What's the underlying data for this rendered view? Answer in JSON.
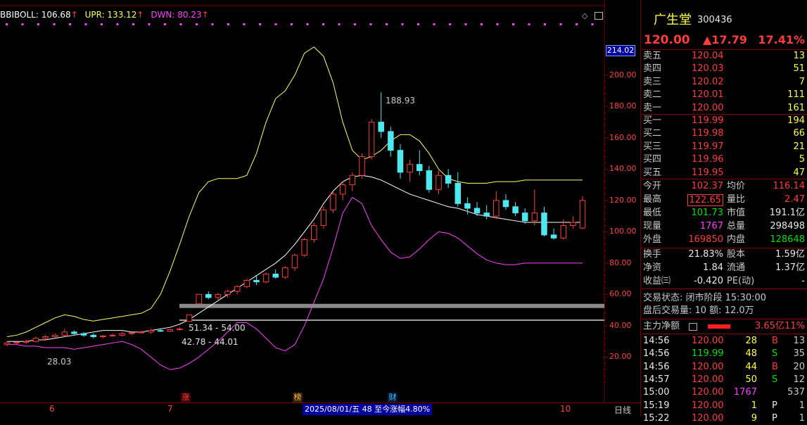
{
  "indicator": {
    "name": "BBIBOLL",
    "bbi_label": "BBIBOLL: 106.68",
    "upr_label": "UPR: 133.12",
    "dwn_label": "DWN: 80.23",
    "colors": {
      "bbi": "#ffffff",
      "upr": "#ffff60",
      "dwn": "#ff40ff"
    }
  },
  "chart": {
    "top_right_price_tag": "214.02",
    "peak_annotation": "188.93",
    "low_annotation": "28.03",
    "gap_labels": [
      "51.34 - 54.00",
      "42.78 - 44.01"
    ],
    "markers": [
      {
        "text": "涨",
        "color": "#ff4040"
      },
      {
        "text": "榜",
        "color": "#ffbb40"
      },
      {
        "text": "财",
        "color": "#40c0ff"
      }
    ],
    "status_bar": "2025/08/01/五 48 至今涨幅4.80%",
    "period_label": "日线",
    "x_ticks": [
      "6",
      "7",
      "10"
    ],
    "colors": {
      "up": "#ff3c3c",
      "down": "#50e8f0",
      "gap": "#a0a0a0"
    }
  },
  "chart_data": {
    "type": "candlestick",
    "ylim": [
      0,
      230
    ],
    "y_ticks": [
      "20.00",
      "40.00",
      "60.00",
      "80.00",
      "100.00",
      "120.00",
      "140.00",
      "160.00",
      "180.00",
      "200.00"
    ],
    "series": [
      {
        "name": "BBIBOLL",
        "values": [
          30,
          30,
          30,
          31,
          31,
          32,
          33,
          34,
          35,
          36,
          37,
          37,
          37,
          36,
          36,
          37,
          38,
          39,
          41,
          44,
          48,
          52,
          56,
          60,
          64,
          68,
          72,
          76,
          80,
          85,
          92,
          100,
          108,
          118,
          126,
          132,
          135,
          136,
          135,
          133,
          130,
          127,
          124,
          122,
          120,
          118,
          116,
          115,
          113,
          111,
          110,
          109,
          108,
          107,
          106,
          106,
          106,
          106,
          106,
          106,
          106
        ]
      },
      {
        "name": "UPR",
        "values": [
          33,
          34,
          36,
          39,
          42,
          45,
          47,
          46,
          44,
          43,
          44,
          45,
          46,
          47,
          48,
          51,
          60,
          75,
          92,
          110,
          125,
          132,
          134,
          134,
          134,
          136,
          150,
          170,
          185,
          190,
          200,
          214,
          218,
          212,
          195,
          170,
          152,
          146,
          148,
          152,
          158,
          162,
          162,
          158,
          150,
          140,
          134,
          132,
          131,
          131,
          131,
          132,
          132,
          132,
          133,
          133,
          133,
          133,
          133,
          133,
          133
        ]
      },
      {
        "name": "DWN",
        "values": [
          28,
          28,
          27,
          27,
          26,
          26,
          26,
          25,
          26,
          27,
          28,
          29,
          30,
          28,
          25,
          20,
          15,
          12,
          13,
          16,
          20,
          25,
          30,
          36,
          42,
          42,
          38,
          32,
          26,
          24,
          28,
          40,
          55,
          70,
          90,
          112,
          122,
          118,
          104,
          95,
          87,
          83,
          84,
          89,
          95,
          100,
          99,
          96,
          91,
          86,
          82,
          80,
          79,
          79,
          80,
          80,
          80,
          80,
          80,
          80,
          80
        ]
      }
    ],
    "candles": [
      {
        "o": 28,
        "h": 30,
        "l": 27,
        "c": 29
      },
      {
        "o": 29,
        "h": 30,
        "l": 28,
        "c": 29.5
      },
      {
        "o": 29.5,
        "h": 31,
        "l": 28.5,
        "c": 30
      },
      {
        "o": 30,
        "h": 33,
        "l": 29.5,
        "c": 32
      },
      {
        "o": 32,
        "h": 34,
        "l": 31,
        "c": 33
      },
      {
        "o": 33,
        "h": 35,
        "l": 32,
        "c": 34
      },
      {
        "o": 34,
        "h": 38,
        "l": 33,
        "c": 36
      },
      {
        "o": 36,
        "h": 37,
        "l": 34,
        "c": 35
      },
      {
        "o": 35,
        "h": 36,
        "l": 33,
        "c": 34
      },
      {
        "o": 34,
        "h": 35,
        "l": 32,
        "c": 33
      },
      {
        "o": 33,
        "h": 34,
        "l": 32,
        "c": 33.5
      },
      {
        "o": 33.5,
        "h": 35,
        "l": 33,
        "c": 34
      },
      {
        "o": 34,
        "h": 36,
        "l": 33,
        "c": 35
      },
      {
        "o": 35,
        "h": 36,
        "l": 34,
        "c": 35.5
      },
      {
        "o": 35.5,
        "h": 37,
        "l": 35,
        "c": 36
      },
      {
        "o": 36,
        "h": 38,
        "l": 35,
        "c": 37
      },
      {
        "o": 37,
        "h": 38,
        "l": 36,
        "c": 36.5
      },
      {
        "o": 36.5,
        "h": 38,
        "l": 36,
        "c": 37.5
      },
      {
        "o": 37.5,
        "h": 39,
        "l": 37,
        "c": 38
      },
      {
        "o": 42.8,
        "h": 47,
        "l": 42.8,
        "c": 47
      },
      {
        "o": 54,
        "h": 60,
        "l": 54,
        "c": 60
      },
      {
        "o": 60,
        "h": 62,
        "l": 57,
        "c": 58
      },
      {
        "o": 58,
        "h": 61,
        "l": 56,
        "c": 60
      },
      {
        "o": 60,
        "h": 63,
        "l": 58,
        "c": 62
      },
      {
        "o": 62,
        "h": 66,
        "l": 60,
        "c": 65
      },
      {
        "o": 65,
        "h": 70,
        "l": 64,
        "c": 69
      },
      {
        "o": 69,
        "h": 72,
        "l": 66,
        "c": 68
      },
      {
        "o": 68,
        "h": 74,
        "l": 67,
        "c": 73
      },
      {
        "o": 73,
        "h": 76,
        "l": 70,
        "c": 71
      },
      {
        "o": 71,
        "h": 78,
        "l": 70,
        "c": 77
      },
      {
        "o": 77,
        "h": 86,
        "l": 75,
        "c": 85
      },
      {
        "o": 85,
        "h": 96,
        "l": 84,
        "c": 95
      },
      {
        "o": 95,
        "h": 106,
        "l": 93,
        "c": 104
      },
      {
        "o": 104,
        "h": 116,
        "l": 102,
        "c": 114
      },
      {
        "o": 114,
        "h": 126,
        "l": 112,
        "c": 124
      },
      {
        "o": 124,
        "h": 132,
        "l": 120,
        "c": 130
      },
      {
        "o": 130,
        "h": 138,
        "l": 126,
        "c": 136
      },
      {
        "o": 136,
        "h": 150,
        "l": 134,
        "c": 148
      },
      {
        "o": 148,
        "h": 172,
        "l": 146,
        "c": 170
      },
      {
        "o": 170,
        "h": 189,
        "l": 160,
        "c": 164
      },
      {
        "o": 164,
        "h": 167,
        "l": 148,
        "c": 152
      },
      {
        "o": 152,
        "h": 156,
        "l": 134,
        "c": 138
      },
      {
        "o": 138,
        "h": 146,
        "l": 132,
        "c": 143
      },
      {
        "o": 143,
        "h": 152,
        "l": 136,
        "c": 139
      },
      {
        "o": 139,
        "h": 142,
        "l": 125,
        "c": 127
      },
      {
        "o": 127,
        "h": 139,
        "l": 124,
        "c": 136
      },
      {
        "o": 136,
        "h": 140,
        "l": 128,
        "c": 131
      },
      {
        "o": 131,
        "h": 138,
        "l": 116,
        "c": 118
      },
      {
        "o": 118,
        "h": 122,
        "l": 111,
        "c": 115
      },
      {
        "o": 115,
        "h": 119,
        "l": 110,
        "c": 112
      },
      {
        "o": 112,
        "h": 117,
        "l": 108,
        "c": 110
      },
      {
        "o": 110,
        "h": 126,
        "l": 108,
        "c": 120
      },
      {
        "o": 120,
        "h": 124,
        "l": 114,
        "c": 116
      },
      {
        "o": 116,
        "h": 119,
        "l": 110,
        "c": 112
      },
      {
        "o": 112,
        "h": 115,
        "l": 105,
        "c": 107
      },
      {
        "o": 107,
        "h": 127,
        "l": 104,
        "c": 112
      },
      {
        "o": 112,
        "h": 116,
        "l": 97,
        "c": 98
      },
      {
        "o": 98,
        "h": 102,
        "l": 95,
        "c": 96
      },
      {
        "o": 96,
        "h": 108,
        "l": 95,
        "c": 104
      },
      {
        "o": 104,
        "h": 110,
        "l": 102,
        "c": 106
      },
      {
        "o": 102.37,
        "h": 122.65,
        "l": 101.73,
        "c": 120
      }
    ]
  },
  "stock": {
    "name": "广生堂",
    "code": "300436",
    "price": "120.00",
    "change": "▲17.79",
    "change_pct": "17.41%"
  },
  "order_book": {
    "asks": [
      {
        "label": "卖五",
        "price": "120.04",
        "vol": "13"
      },
      {
        "label": "卖四",
        "price": "120.03",
        "vol": "51"
      },
      {
        "label": "卖三",
        "price": "120.02",
        "vol": "7"
      },
      {
        "label": "卖二",
        "price": "120.01",
        "vol": "111"
      },
      {
        "label": "卖一",
        "price": "120.00",
        "vol": "161"
      }
    ],
    "bids": [
      {
        "label": "买一",
        "price": "119.99",
        "vol": "194"
      },
      {
        "label": "买二",
        "price": "119.98",
        "vol": "66"
      },
      {
        "label": "买三",
        "price": "119.97",
        "vol": "21"
      },
      {
        "label": "买四",
        "price": "119.96",
        "vol": "5"
      },
      {
        "label": "买五",
        "price": "119.95",
        "vol": "47"
      }
    ]
  },
  "quote": {
    "rows": [
      {
        "l1": "今开",
        "v1": "102.37",
        "l2": "均价",
        "v2": "116.14"
      },
      {
        "l1": "最高",
        "v1": "122.65",
        "l2": "量比",
        "v2": "2.47"
      },
      {
        "l1": "最低",
        "v1": "101.73",
        "l2": "市值",
        "v2": "191.1亿"
      },
      {
        "l1": "现量",
        "v1": "1767",
        "l2": "总量",
        "v2": "298498"
      },
      {
        "l1": "外盘",
        "v1": "169850",
        "l2": "内盘",
        "v2": "128648"
      }
    ],
    "rows2": [
      {
        "l1": "换手",
        "v1": "21.83%",
        "l2": "股本",
        "v2": "1.59亿"
      },
      {
        "l1": "净资",
        "v1": "1.84",
        "l2": "流通",
        "v2": "1.37亿"
      },
      {
        "l1": "收益㈢",
        "v1": "-0.420",
        "l2": "PE(动)",
        "v2": "-"
      }
    ]
  },
  "trading_status": {
    "line1": "交易状态: 闭市阶段 15:30:00",
    "line2": "盘后交易量: 10  额: 12.0万"
  },
  "main_flow": {
    "label": "主力净额",
    "value": "3.65亿",
    "pct": "11%"
  },
  "ticks": [
    {
      "time": "14:56",
      "price": "120.00",
      "vol": "28",
      "side": "B",
      "num": "13"
    },
    {
      "time": "14:56",
      "price": "119.99",
      "vol": "48",
      "side": "S",
      "num": "35"
    },
    {
      "time": "14:56",
      "price": "120.00",
      "vol": "44",
      "side": "B",
      "num": "20"
    },
    {
      "time": "14:57",
      "price": "120.00",
      "vol": "50",
      "side": "S",
      "num": "12"
    },
    {
      "time": "15:00",
      "price": "120.00",
      "vol": "1767",
      "side": "",
      "num": "537"
    },
    {
      "time": "15:19",
      "price": "120.00",
      "vol": "1",
      "side": "P",
      "num": "1"
    },
    {
      "time": "15:22",
      "price": "120.00",
      "vol": "9",
      "side": "P",
      "num": "1"
    }
  ]
}
